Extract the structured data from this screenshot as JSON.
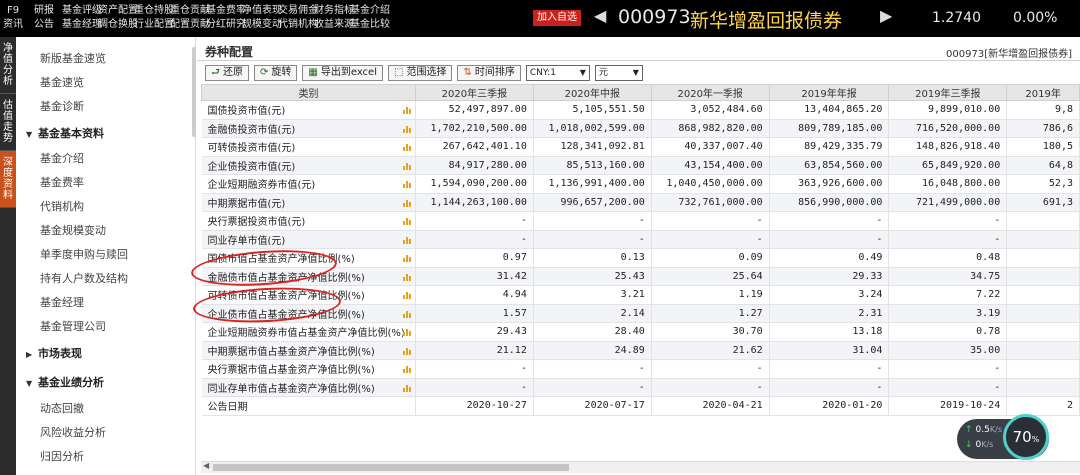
{
  "topbar": {
    "menu": [
      {
        "top": "F9",
        "bottom": "资讯"
      },
      {
        "top": "研报",
        "bottom": "公告"
      },
      {
        "top": "基金评级",
        "bottom": "基金经理"
      },
      {
        "top": "资产配置",
        "bottom": "调仓换股"
      },
      {
        "top": "重仓持股",
        "bottom": "行业配置"
      },
      {
        "top": "重仓贡献",
        "bottom": "配置贡献"
      },
      {
        "top": "基金费率",
        "bottom": "分红研究"
      },
      {
        "top": "净值表现",
        "bottom": "规模变动"
      },
      {
        "top": "交易佣金",
        "bottom": "代销机构"
      },
      {
        "top": "财务指标",
        "bottom": "收益来源"
      },
      {
        "top": "基金介绍",
        "bottom": "基金比较"
      }
    ],
    "add_watch": "加入自选",
    "fund_code": "000973",
    "fund_name": "新华增盈回报债券",
    "price": "1.2740",
    "change_pct": "0.00%"
  },
  "vtabs": [
    {
      "label": [
        "净",
        "值",
        "分",
        "析"
      ],
      "active": false
    },
    {
      "label": [
        "估",
        "值",
        "走",
        "势"
      ],
      "active": false
    },
    {
      "label": [
        "深",
        "度",
        "资",
        "料"
      ],
      "active": true
    }
  ],
  "sidebar": {
    "items": [
      {
        "type": "item",
        "label": "新版基金速览"
      },
      {
        "type": "item",
        "label": "基金速览"
      },
      {
        "type": "item",
        "label": "基金诊断"
      },
      {
        "type": "group",
        "label": "基金基本资料",
        "expanded": true
      },
      {
        "type": "item",
        "label": "基金介绍"
      },
      {
        "type": "item",
        "label": "基金费率"
      },
      {
        "type": "item",
        "label": "代销机构"
      },
      {
        "type": "item",
        "label": "基金规模变动"
      },
      {
        "type": "item",
        "label": "单季度申购与赎回"
      },
      {
        "type": "item",
        "label": "持有人户数及结构"
      },
      {
        "type": "item",
        "label": "基金经理"
      },
      {
        "type": "item",
        "label": "基金管理公司"
      },
      {
        "type": "group",
        "label": "市场表现",
        "expanded": false
      },
      {
        "type": "group",
        "label": "基金业绩分析",
        "expanded": true
      },
      {
        "type": "item",
        "label": "动态回撤"
      },
      {
        "type": "item",
        "label": "风险收益分析"
      },
      {
        "type": "item",
        "label": "归因分析"
      }
    ]
  },
  "main": {
    "title": "券种配置",
    "fund_label": "000973[新华增盈回报债券]",
    "toolbar": {
      "restore": "还原",
      "rotate": "旋转",
      "export": "导出到excel",
      "range_select": "范围选择",
      "time_sort": "时间排序",
      "currency": "CNY:1",
      "unit": "元"
    },
    "table": {
      "headers": [
        "类别",
        "2020年三季报",
        "2020年中报",
        "2020年一季报",
        "2019年年报",
        "2019年三季报",
        "2019年"
      ],
      "rows": [
        {
          "cat": "国债投资市值(元)",
          "vals": [
            "52,497,897.00",
            "5,105,551.50",
            "3,052,484.60",
            "13,404,865.20",
            "9,899,010.00",
            "9,8"
          ]
        },
        {
          "cat": "金融债投资市值(元)",
          "vals": [
            "1,702,210,500.00",
            "1,018,002,599.00",
            "868,982,820.00",
            "809,789,185.00",
            "716,520,000.00",
            "786,6"
          ]
        },
        {
          "cat": "可转债投资市值(元)",
          "vals": [
            "267,642,401.10",
            "128,341,092.81",
            "40,337,007.40",
            "89,429,335.79",
            "148,826,918.40",
            "180,5"
          ]
        },
        {
          "cat": "企业债投资市值(元)",
          "vals": [
            "84,917,280.00",
            "85,513,160.00",
            "43,154,400.00",
            "63,854,560.00",
            "65,849,920.00",
            "64,8"
          ]
        },
        {
          "cat": "企业短期融资券市值(元)",
          "vals": [
            "1,594,090,200.00",
            "1,136,991,400.00",
            "1,040,450,000.00",
            "363,926,600.00",
            "16,048,800.00",
            "52,3"
          ]
        },
        {
          "cat": "中期票据市值(元)",
          "vals": [
            "1,144,263,100.00",
            "996,657,200.00",
            "732,761,000.00",
            "856,990,000.00",
            "721,499,000.00",
            "691,3"
          ]
        },
        {
          "cat": "央行票据投资市值(元)",
          "vals": [
            "-",
            "-",
            "-",
            "-",
            "-",
            ""
          ]
        },
        {
          "cat": "同业存单市值(元)",
          "vals": [
            "-",
            "-",
            "-",
            "-",
            "-",
            ""
          ]
        },
        {
          "cat": "国债市值占基金资产净值比例(%)",
          "vals": [
            "0.97",
            "0.13",
            "0.09",
            "0.49",
            "0.48",
            ""
          ]
        },
        {
          "cat": "金融债市值占基金资产净值比例(%)",
          "vals": [
            "31.42",
            "25.43",
            "25.64",
            "29.33",
            "34.75",
            ""
          ]
        },
        {
          "cat": "可转债市值占基金资产净值比例(%)",
          "vals": [
            "4.94",
            "3.21",
            "1.19",
            "3.24",
            "7.22",
            ""
          ]
        },
        {
          "cat": "企业债市值占基金资产净值比例(%)",
          "vals": [
            "1.57",
            "2.14",
            "1.27",
            "2.31",
            "3.19",
            ""
          ]
        },
        {
          "cat": "企业短期融资券市值占基金资产净值比例(%)",
          "vals": [
            "29.43",
            "28.40",
            "30.70",
            "13.18",
            "0.78",
            ""
          ]
        },
        {
          "cat": "中期票据市值占基金资产净值比例(%)",
          "vals": [
            "21.12",
            "24.89",
            "21.62",
            "31.04",
            "35.00",
            ""
          ]
        },
        {
          "cat": "央行票据市值占基金资产净值比例(%)",
          "vals": [
            "-",
            "-",
            "-",
            "-",
            "-",
            ""
          ]
        },
        {
          "cat": "同业存单市值占基金资产净值比例(%)",
          "vals": [
            "-",
            "-",
            "-",
            "-",
            "-",
            ""
          ]
        },
        {
          "cat": "公告日期",
          "vals": [
            "2020-10-27",
            "2020-07-17",
            "2020-04-21",
            "2020-01-20",
            "2019-10-24",
            "2"
          ],
          "no_icon": true
        }
      ]
    }
  },
  "net_widget": {
    "up": "0.5",
    "up_unit": "K/s",
    "down": "0",
    "down_unit": "K/s",
    "gauge": "70",
    "gauge_unit": "%"
  },
  "colors": {
    "topbar_bg": "#000000",
    "fund_name": "#ffd34a",
    "add_watch_bg": "#c8221b",
    "active_tab": "#c8521b",
    "annotation": "#d8231f"
  }
}
